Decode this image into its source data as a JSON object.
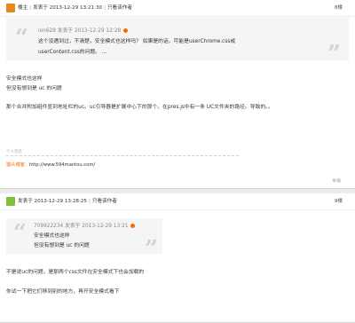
{
  "post1": {
    "author": "楼主",
    "posted": "发表于 2013-12-29 13:21:30",
    "only_author": "只看该作者",
    "floor": "8楼",
    "quote": {
      "meta_user": "ion628",
      "meta_time": "发表于 2013-12-29 12:28",
      "lines": [
        "这个没遇到过，不清楚，安全模式也这样吗？ 如果是的话，可能是userChrome.css或",
        "userContent.css的问题。  ..."
      ]
    },
    "body": [
      "安全模式也这样",
      "但没有想到是 uc 的问题",
      "那个合并附加组件显到地址栏的uc。uc引导器是扩展中心下的那个。在pres.js中有一条 UC文件夹的路径。导致的。。"
    ],
    "sig_label": "个人签名",
    "signature": {
      "prefix": "猎头博客：",
      "url": "http://www.594mantou.com/"
    },
    "report": "举报"
  },
  "post2": {
    "posted": "发表于 2013-12-29 13:28:25",
    "only_author": "只看该作者",
    "floor": "9楼",
    "quote": {
      "meta_user": "709922234",
      "meta_time": "发表于 2013-12-29 13:21",
      "lines": [
        "安全模式也这样",
        "但没有想到是 uc 的问题"
      ]
    },
    "body": [
      "不是说uc的问题，是那两个css文件在安全模式下也会加载的",
      "你试一下把它们移到别的地方，再开安全模式看下"
    ]
  },
  "colors": {
    "accent": "#ff6600",
    "link": "#336699",
    "avatar1": "#e58a1a",
    "avatar2": "#7fbf3a"
  }
}
